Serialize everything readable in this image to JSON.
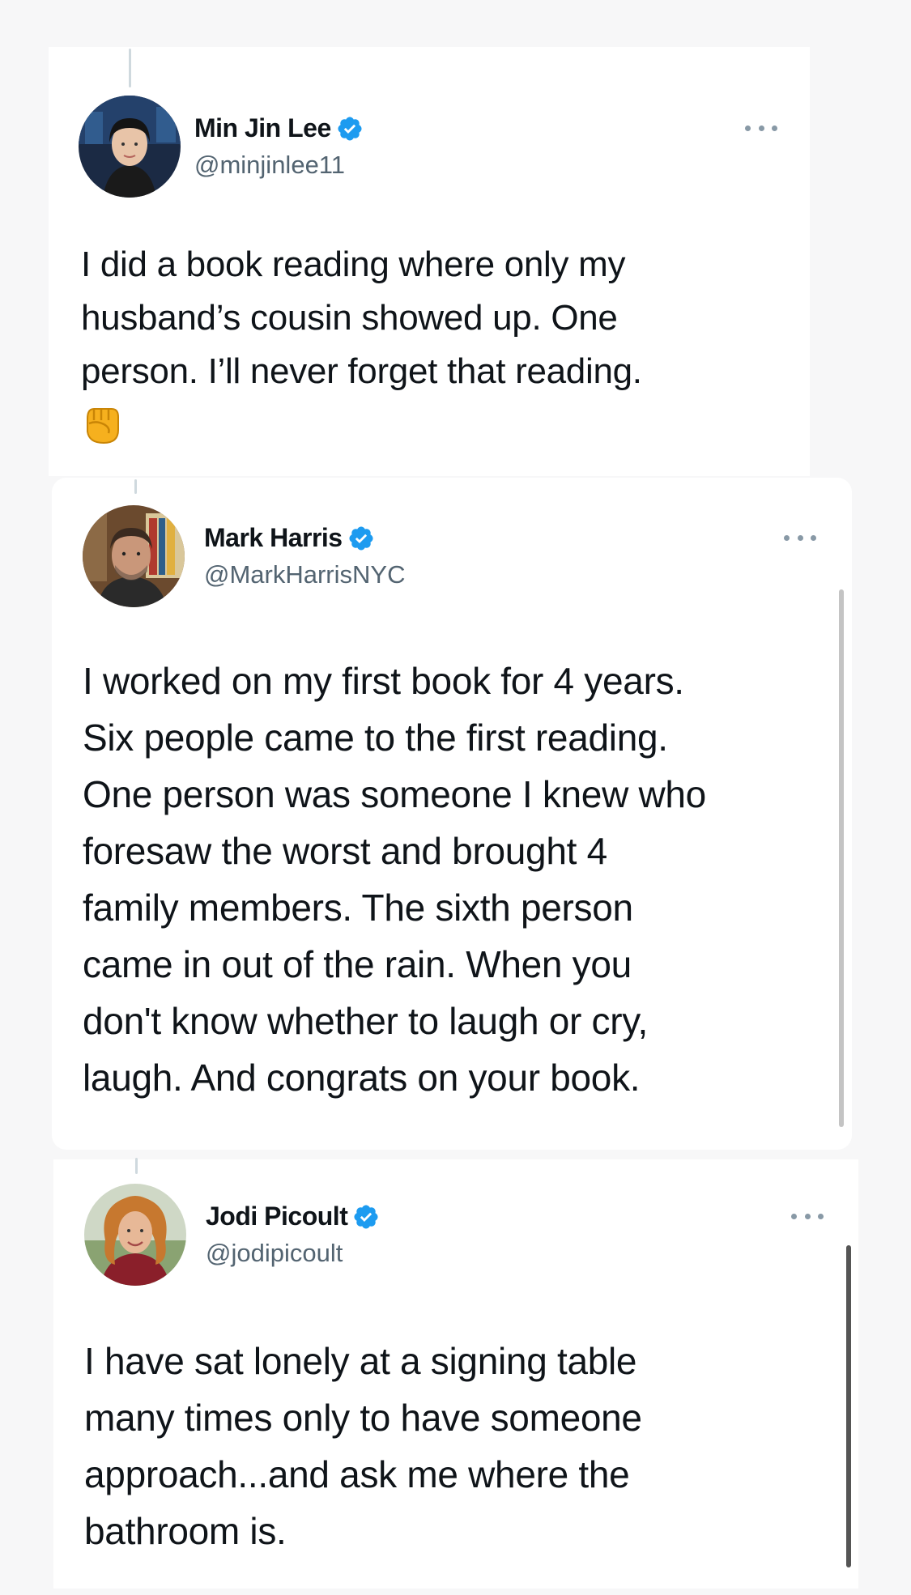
{
  "tweets": [
    {
      "name": "Min Jin Lee",
      "handle": "@minjinlee11",
      "text": "I did a book reading where only my\nhusband’s cousin showed up. One\nperson. I’ll never forget that reading.",
      "emoji": "raised-fist",
      "verified": true,
      "avatar": "avatar-min-jin-lee"
    },
    {
      "name": "Mark Harris",
      "handle": "@MarkHarrisNYC",
      "text": "I worked on my first book for 4 years.\nSix people came to the first reading.\nOne person was someone I knew who\nforesaw the worst and brought 4\nfamily members. The sixth person\ncame in out of the rain. When you\ndon't know whether to laugh or cry,\nlaugh. And congrats on your book.",
      "verified": true,
      "avatar": "avatar-mark-harris"
    },
    {
      "name": "Jodi Picoult",
      "handle": "@jodipicoult",
      "text": "I have sat lonely at a signing table\nmany times only to have someone\napproach...and ask me where the\nbathroom is.",
      "verified": true,
      "avatar": "avatar-jodi-picoult"
    }
  ],
  "icons": {
    "verified": "verified-badge-icon",
    "more": "more-options-icon"
  },
  "colors": {
    "verified": "#1d9bf0",
    "text": "#0f1419",
    "secondary": "#536471",
    "background": "#f7f7f8",
    "card": "#ffffff"
  }
}
